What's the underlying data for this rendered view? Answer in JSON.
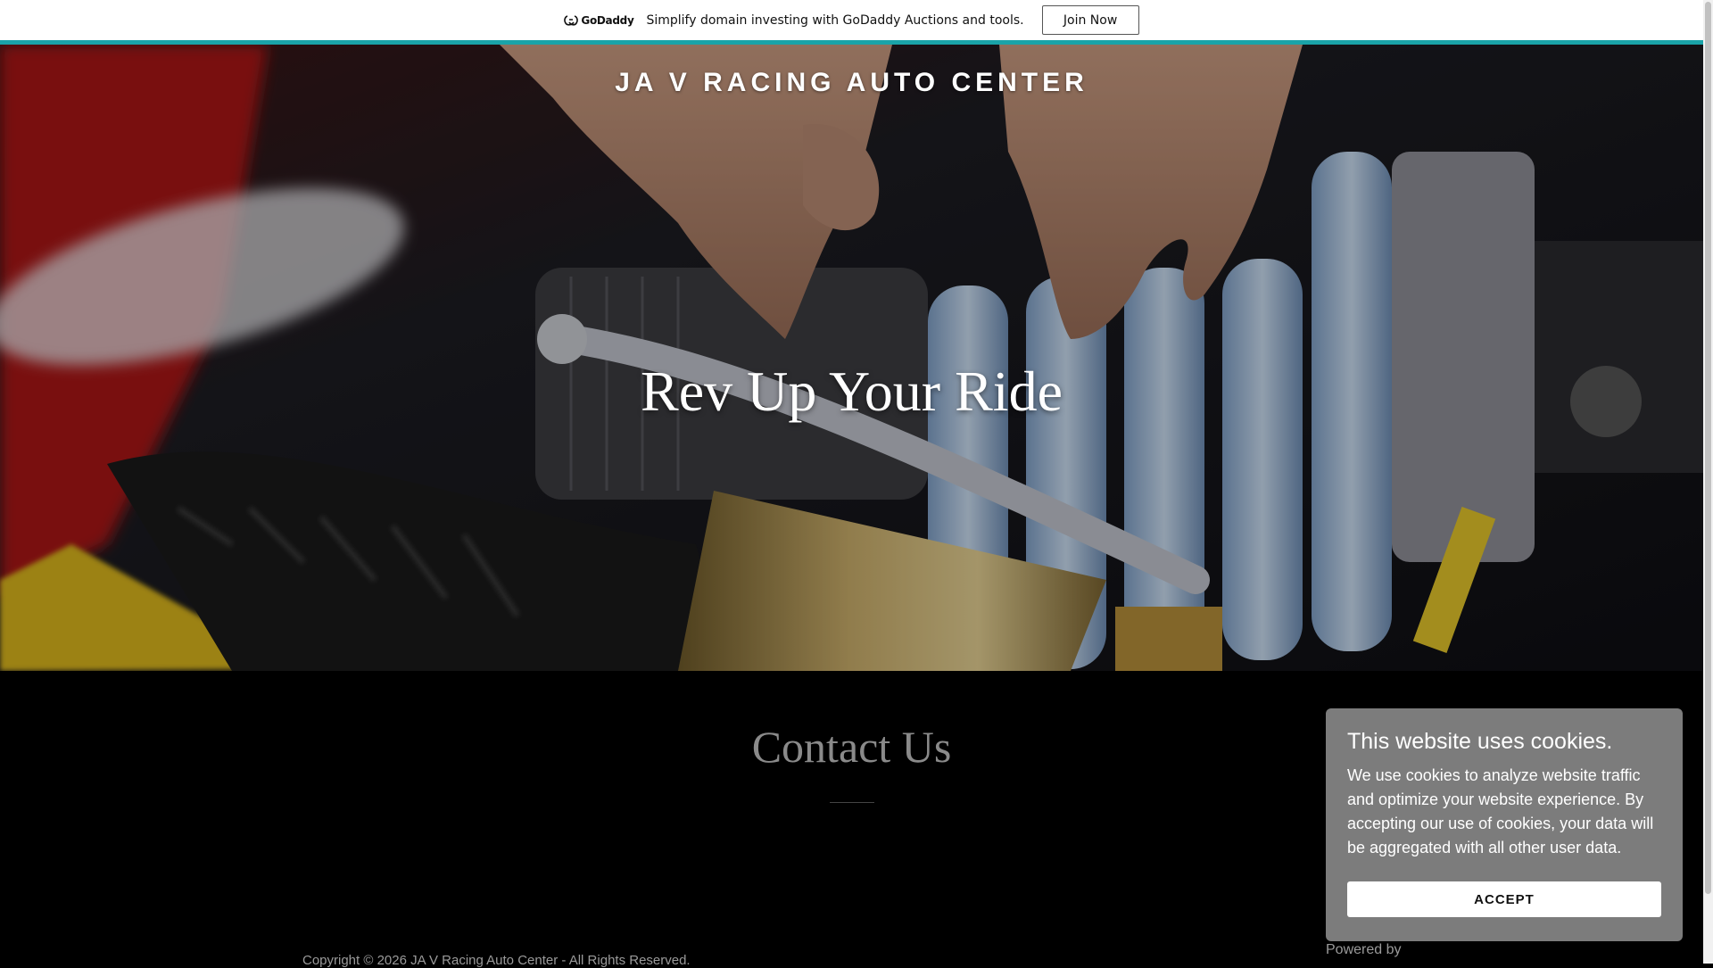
{
  "promo": {
    "logo_text": "GoDaddy",
    "message": "Simplify domain investing with GoDaddy Auctions and tools.",
    "cta_label": "Join Now",
    "accent_color": "#1aa3a8"
  },
  "hero": {
    "site_title": "JA V RACING AUTO CENTER",
    "headline": "Rev Up Your Ride"
  },
  "contact": {
    "title": "Contact Us"
  },
  "footer": {
    "copyright": "Copyright © 2026 JA V Racing Auto Center - All Rights Reserved.",
    "powered_by": "Powered by"
  },
  "cookie_banner": {
    "title": "This website uses cookies.",
    "body": "We use cookies to analyze website traffic and optimize your website experience. By accepting our use of cookies, your data will be aggregated with all other user data.",
    "accept_label": "ACCEPT"
  }
}
